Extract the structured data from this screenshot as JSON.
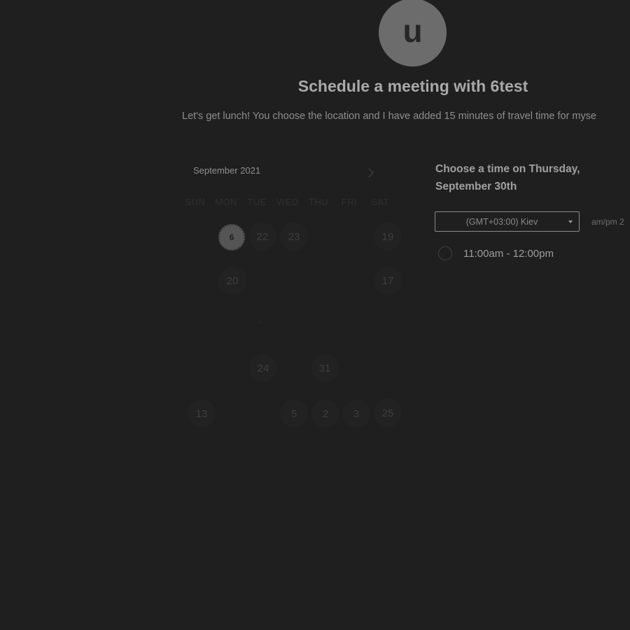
{
  "avatar": {
    "initial": "u"
  },
  "header": {
    "title": "Schedule a meeting with 6test",
    "description": "Let's get lunch! You choose the location and I have added 15 minutes of travel time for myse"
  },
  "calendar": {
    "month_label": "September 2021",
    "next_icon": "chevron-right-icon",
    "weekdays": [
      "SUN",
      "MON",
      "TUE",
      "WED",
      "THU",
      "FRI",
      "SAT"
    ],
    "days": [
      {
        "label": "6",
        "state": "selected"
      },
      {
        "label": "22"
      },
      {
        "label": "23"
      },
      {
        "label": "19"
      },
      {
        "label": "20"
      },
      {
        "label": "17"
      },
      {
        "label": "·"
      },
      {
        "label": "24"
      },
      {
        "label": "31"
      },
      {
        "label": "13"
      },
      {
        "label": "5"
      },
      {
        "label": "2"
      },
      {
        "label": "3"
      },
      {
        "label": "25"
      }
    ]
  },
  "panel": {
    "choose_title": "Choose a time on Thursday, September 30th",
    "timezone": {
      "selected": "(GMT+03:00) Kiev",
      "caret_icon": "caret-down-icon"
    },
    "format_toggle": "am/pm  2",
    "slots": [
      {
        "label": "11:00am - 12:00pm"
      }
    ]
  }
}
